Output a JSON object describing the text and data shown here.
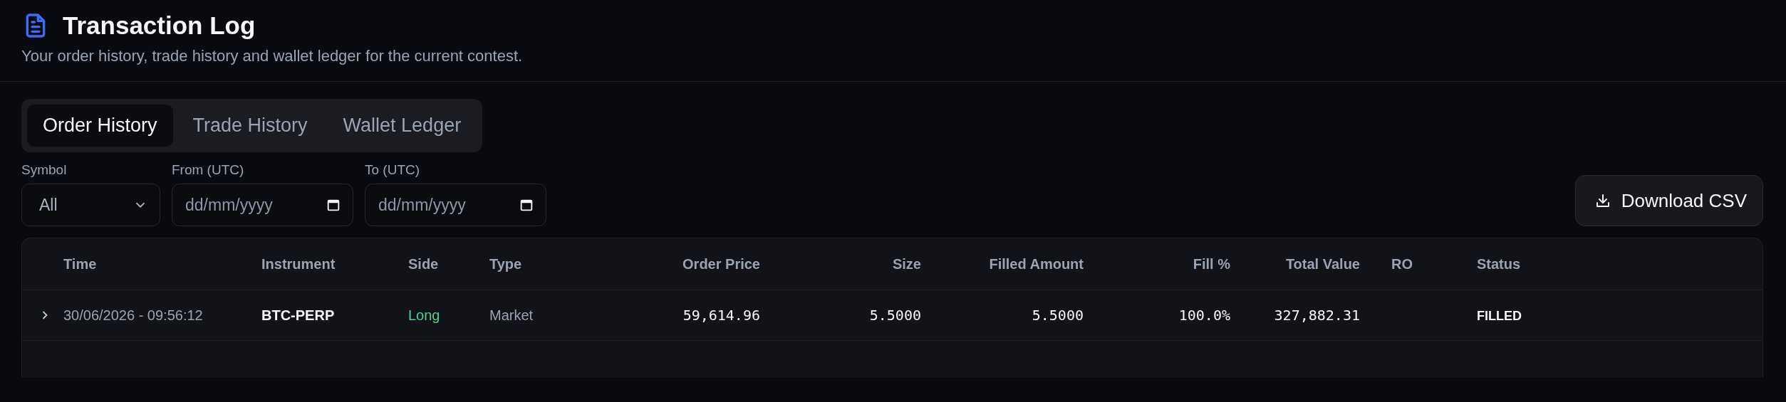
{
  "header": {
    "title": "Transaction Log",
    "subtitle": "Your order history, trade history and wallet ledger for the current contest."
  },
  "tabs": [
    {
      "label": "Order History",
      "selected": true
    },
    {
      "label": "Trade History",
      "selected": false
    },
    {
      "label": "Wallet Ledger",
      "selected": false
    }
  ],
  "filters": [
    {
      "kind": "select",
      "label": "Symbol",
      "value": "All"
    },
    {
      "kind": "date",
      "label": "From (UTC)",
      "placeholder": "dd/mm/yyyy"
    },
    {
      "kind": "date",
      "label": "To (UTC)",
      "placeholder": "dd/mm/yyyy"
    }
  ],
  "download_button": {
    "label": "Download CSV"
  },
  "table": {
    "columns": [
      "Time",
      "Instrument",
      "Side",
      "Type",
      "Order Price",
      "Size",
      "Filled Amount",
      "Fill %",
      "Total Value",
      "RO",
      "Status"
    ],
    "rows": [
      {
        "expanded": false,
        "time": "30/06/2026 - 09:56:12",
        "instrument": "BTC-PERP",
        "side": {
          "text": "Long",
          "kind": "long"
        },
        "type": "Market",
        "order_price": "59,614.96",
        "size": "5.5000",
        "filled_amount": "5.5000",
        "fill_pct": "100.0%",
        "total_value": "327,882.31",
        "status": "FILLED"
      }
    ]
  }
}
